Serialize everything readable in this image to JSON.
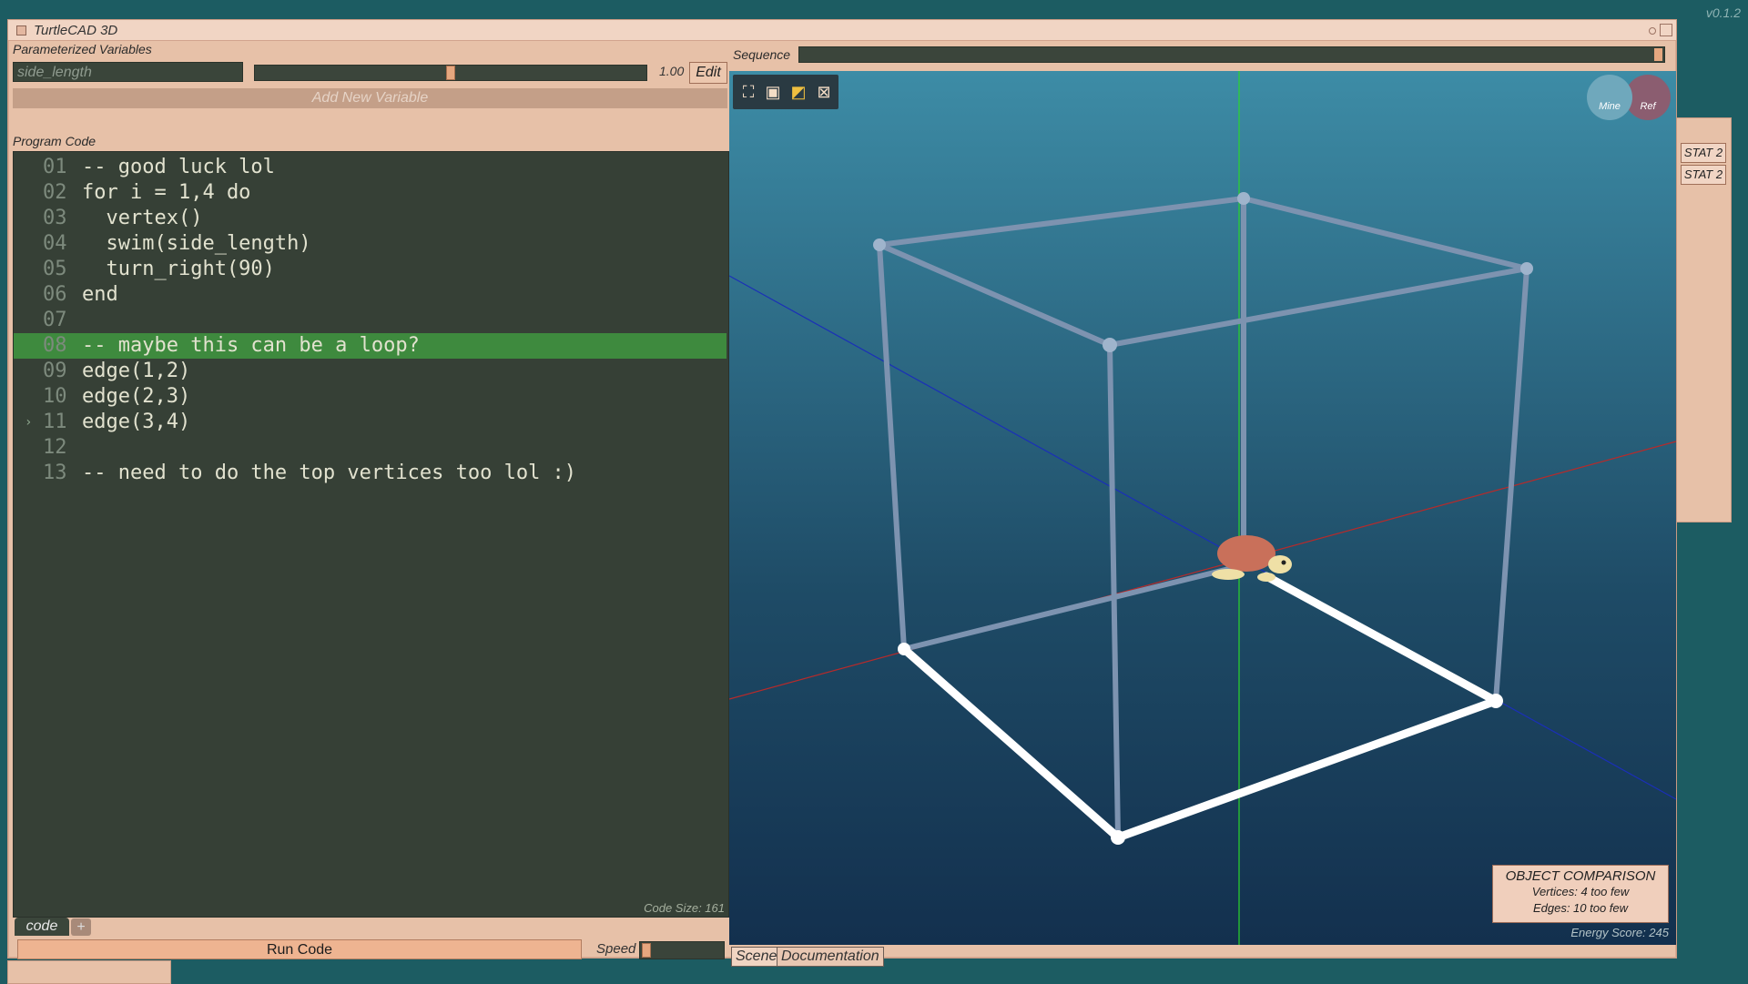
{
  "version": "v0.1.2",
  "window": {
    "title": "TurtleCAD 3D"
  },
  "variables": {
    "header": "Parameterized Variables",
    "name": "side_length",
    "value": "1.00",
    "edit_label": "Edit",
    "add_label": "Add New Variable",
    "slider_fraction": 0.5
  },
  "code": {
    "header": "Program Code",
    "lines": [
      {
        "n": "01",
        "text": "-- good luck lol"
      },
      {
        "n": "02",
        "text": "for i = 1,4 do"
      },
      {
        "n": "03",
        "text": "  vertex()"
      },
      {
        "n": "04",
        "text": "  swim(side_length)"
      },
      {
        "n": "05",
        "text": "  turn_right(90)"
      },
      {
        "n": "06",
        "text": "end"
      },
      {
        "n": "07",
        "text": ""
      },
      {
        "n": "08",
        "text": "-- maybe this can be a loop?"
      },
      {
        "n": "09",
        "text": "edge(1,2)"
      },
      {
        "n": "10",
        "text": "edge(2,3)"
      },
      {
        "n": "11",
        "text": "edge(3,4)"
      },
      {
        "n": "12",
        "text": ""
      },
      {
        "n": "13",
        "text": "-- need to do the top vertices too lol :)"
      }
    ],
    "highlighted_line": "08",
    "marker_line": "11",
    "code_size": "Code Size: 161"
  },
  "tabs": {
    "code": "code",
    "plus": "+"
  },
  "run": {
    "label": "Run Code",
    "speed_label": "Speed"
  },
  "sequence": {
    "label": "Sequence"
  },
  "viewport": {
    "mine": "Mine",
    "ref": "Ref",
    "comparison": {
      "title": "OBJECT COMPARISON",
      "vertices": "Vertices: 4 too few",
      "edges": "Edges: 10 too few"
    },
    "energy": "Energy Score: 245"
  },
  "view_tabs": {
    "scene": "Scene",
    "docs": "Documentation"
  },
  "stats": [
    "STAT 2",
    "STAT 2"
  ],
  "colors": {
    "background": "#1c5c62",
    "panel": "#e7c1a8",
    "editor": "#364036",
    "highlight": "#3e8a3e",
    "accent": "#eeb491"
  }
}
